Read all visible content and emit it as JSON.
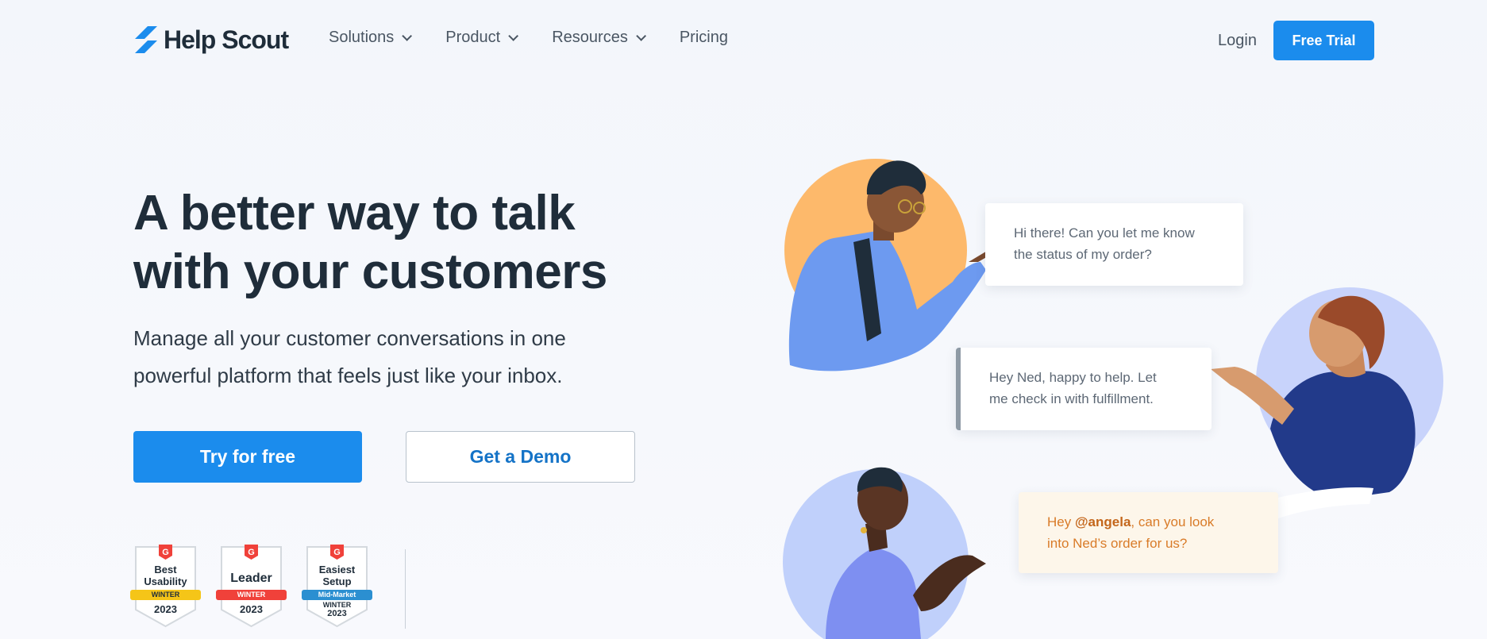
{
  "brand": {
    "name": "Help Scout",
    "accent": "#1b8ced"
  },
  "nav": {
    "items": [
      {
        "label": "Solutions",
        "has_dropdown": true
      },
      {
        "label": "Product",
        "has_dropdown": true
      },
      {
        "label": "Resources",
        "has_dropdown": true
      },
      {
        "label": "Pricing",
        "has_dropdown": false
      }
    ],
    "login": "Login",
    "cta": "Free Trial"
  },
  "hero": {
    "headline_line1": "A better way to talk",
    "headline_line2": "with your customers",
    "subhead_line1": "Manage all your customer conversations in one",
    "subhead_line2": "powerful platform that feels just like your inbox.",
    "primary_cta": "Try for free",
    "secondary_cta": "Get a Demo"
  },
  "badges": [
    {
      "line1": "Best",
      "line2": "Usability",
      "band": "WINTER",
      "band_color": "#f5c518",
      "year": "2023"
    },
    {
      "line1": "Leader",
      "line2": "",
      "band": "WINTER",
      "band_color": "#f0413a",
      "year": "2023"
    },
    {
      "line1": "Easiest",
      "line2": "Setup",
      "band": "Mid-Market",
      "band_color": "#2b8fd1",
      "year_line1": "WINTER",
      "year": "2023"
    }
  ],
  "chat": {
    "bubble1_line1": "Hi there! Can you let me know",
    "bubble1_line2": "the status of my order?",
    "bubble2_line1": "Hey Ned, happy to help. Let",
    "bubble2_line2": "me check in with fulfillment.",
    "bubble3_prefix": "Hey ",
    "bubble3_mention": "@angela",
    "bubble3_suffix": ", can you look",
    "bubble3_line2": "into Ned’s order for us?"
  }
}
